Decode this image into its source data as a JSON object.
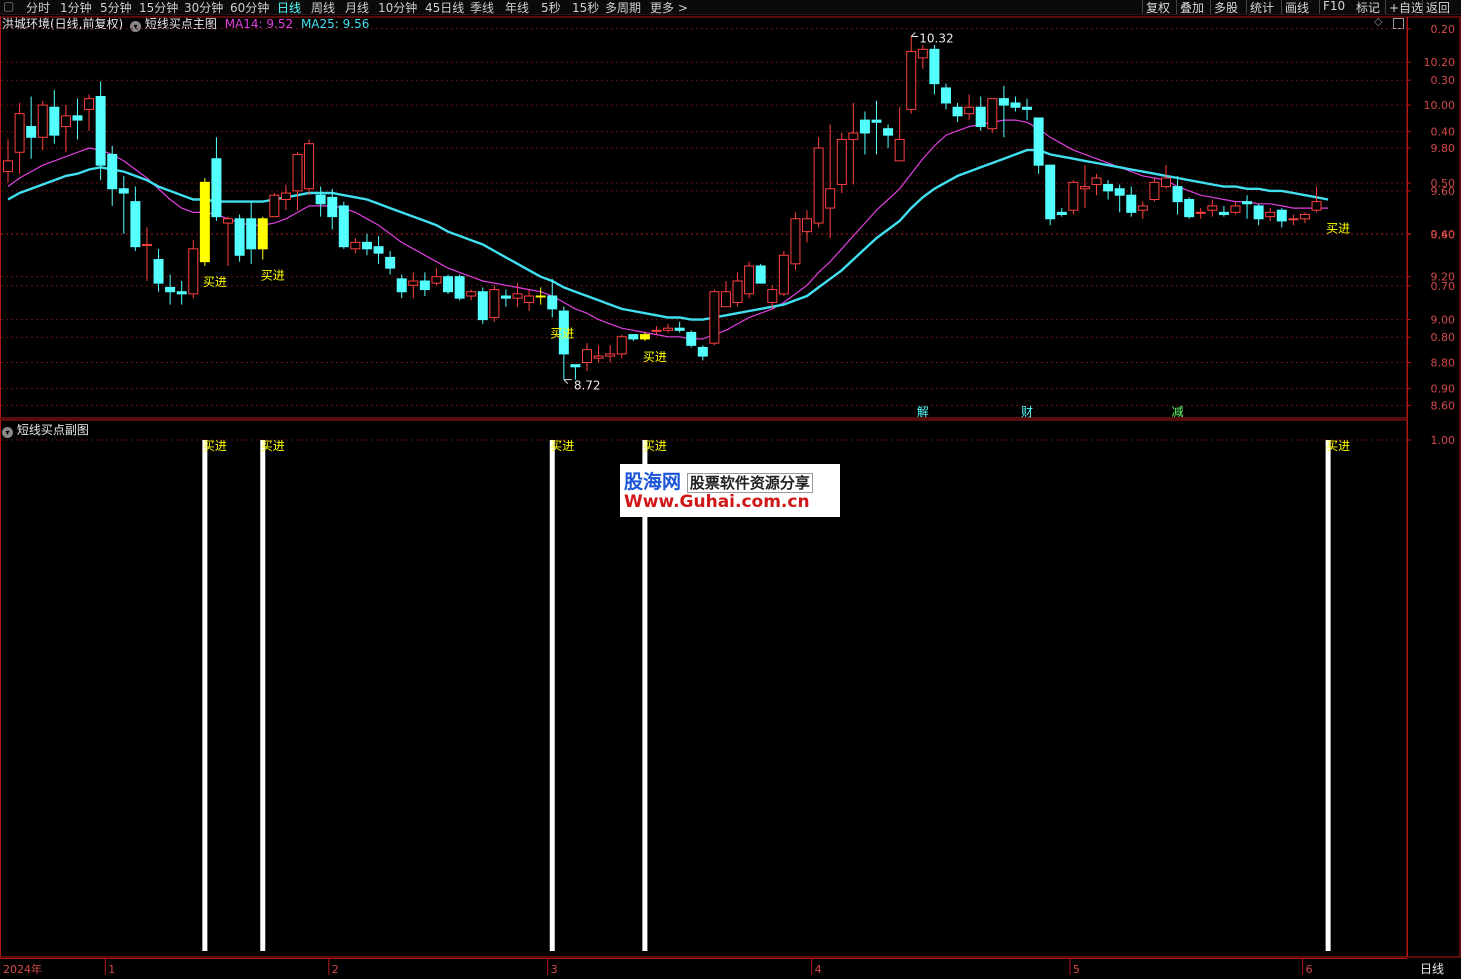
{
  "toolbar": {
    "icon": "square-icon",
    "periods": [
      "分时",
      "1分钟",
      "5分钟",
      "15分钟",
      "30分钟",
      "60分钟",
      "日线",
      "周线",
      "月线",
      "10分钟",
      "45日线",
      "季线",
      "年线",
      "5秒",
      "15秒",
      "多周期",
      "更多 >"
    ],
    "active_period": "日线",
    "right_buttons": [
      "复权",
      "叠加",
      "多股",
      "统计",
      "画线",
      "F10",
      "+自选",
      "返回"
    ],
    "note_button": "标记"
  },
  "main_panel": {
    "stock_title": "洪城环境(日线,前复权)",
    "indicator_name": "短线买点主图",
    "ma14_label": "MA14: 9.52",
    "ma25_label": "MA25: 9.56",
    "high_label": "10.32",
    "low_label": "8.72",
    "signal_text": "买进",
    "event_tags": [
      "解",
      "财",
      "减"
    ]
  },
  "sub_panel": {
    "indicator_name": "短线买点副图",
    "signal_text": "买进"
  },
  "watermark": {
    "line1_a": "股海网",
    "line1_b": "股票软件资源分享",
    "line2": "Www.Guhai.com.cn"
  },
  "x_axis": {
    "labels": [
      "2024年",
      "1",
      "2",
      "3",
      "4",
      "5",
      "6"
    ],
    "period_tag": "日线"
  },
  "colors": {
    "up": "#ff4040",
    "down": "#54ffff",
    "highlight": "#ffff00",
    "ma14": "#e040e0",
    "ma25": "#40e0f0",
    "axis": "#b01818",
    "grid": "#6a1212"
  },
  "chart_data": {
    "type": "candlestick",
    "main_price_axis": [
      8.6,
      8.8,
      9.0,
      9.2,
      9.4,
      9.6,
      9.8,
      10.0,
      10.2
    ],
    "sub_axis": [
      0.2,
      0.3,
      0.4,
      0.5,
      0.6,
      0.7,
      0.8,
      0.9,
      1.0
    ],
    "candles": [
      {
        "o": 9.69,
        "h": 9.84,
        "l": 9.64,
        "c": 9.74
      },
      {
        "o": 9.78,
        "h": 10.01,
        "l": 9.68,
        "c": 9.96
      },
      {
        "o": 9.9,
        "h": 10.04,
        "l": 9.75,
        "c": 9.85
      },
      {
        "o": 9.85,
        "h": 10.02,
        "l": 9.79,
        "c": 10.0
      },
      {
        "o": 9.99,
        "h": 10.07,
        "l": 9.82,
        "c": 9.86
      },
      {
        "o": 9.9,
        "h": 10.0,
        "l": 9.78,
        "c": 9.95
      },
      {
        "o": 9.95,
        "h": 10.03,
        "l": 9.84,
        "c": 9.93
      },
      {
        "o": 9.98,
        "h": 10.05,
        "l": 9.88,
        "c": 10.03
      },
      {
        "o": 10.04,
        "h": 10.11,
        "l": 9.65,
        "c": 9.72
      },
      {
        "o": 9.77,
        "h": 9.81,
        "l": 9.53,
        "c": 9.61
      },
      {
        "o": 9.61,
        "h": 9.67,
        "l": 9.4,
        "c": 9.59
      },
      {
        "o": 9.55,
        "h": 9.62,
        "l": 9.32,
        "c": 9.34
      },
      {
        "o": 9.35,
        "h": 9.43,
        "l": 9.18,
        "c": 9.35
      },
      {
        "o": 9.28,
        "h": 9.33,
        "l": 9.13,
        "c": 9.17
      },
      {
        "o": 9.15,
        "h": 9.21,
        "l": 9.07,
        "c": 9.13
      },
      {
        "o": 9.13,
        "h": 9.18,
        "l": 9.07,
        "c": 9.12
      },
      {
        "o": 9.12,
        "h": 9.37,
        "l": 9.1,
        "c": 9.33
      },
      {
        "o": 9.27,
        "h": 9.66,
        "l": 9.25,
        "c": 9.64
      },
      {
        "o": 9.75,
        "h": 9.85,
        "l": 9.46,
        "c": 9.48
      },
      {
        "o": 9.45,
        "h": 9.48,
        "l": 9.25,
        "c": 9.47
      },
      {
        "o": 9.47,
        "h": 9.49,
        "l": 9.27,
        "c": 9.3
      },
      {
        "o": 9.47,
        "h": 9.55,
        "l": 9.26,
        "c": 9.33
      },
      {
        "o": 9.33,
        "h": 9.48,
        "l": 9.28,
        "c": 9.47
      },
      {
        "o": 9.48,
        "h": 9.59,
        "l": 9.48,
        "c": 9.58
      },
      {
        "o": 9.56,
        "h": 9.63,
        "l": 9.51,
        "c": 9.59
      },
      {
        "o": 9.6,
        "h": 9.78,
        "l": 9.51,
        "c": 9.77
      },
      {
        "o": 9.61,
        "h": 9.84,
        "l": 9.58,
        "c": 9.82
      },
      {
        "o": 9.58,
        "h": 9.62,
        "l": 9.48,
        "c": 9.54
      },
      {
        "o": 9.57,
        "h": 9.61,
        "l": 9.42,
        "c": 9.48
      },
      {
        "o": 9.53,
        "h": 9.55,
        "l": 9.33,
        "c": 9.34
      },
      {
        "o": 9.33,
        "h": 9.38,
        "l": 9.31,
        "c": 9.36
      },
      {
        "o": 9.36,
        "h": 9.4,
        "l": 9.3,
        "c": 9.33
      },
      {
        "o": 9.34,
        "h": 9.39,
        "l": 9.26,
        "c": 9.31
      },
      {
        "o": 9.29,
        "h": 9.32,
        "l": 9.21,
        "c": 9.24
      },
      {
        "o": 9.19,
        "h": 9.21,
        "l": 9.1,
        "c": 9.13
      },
      {
        "o": 9.16,
        "h": 9.22,
        "l": 9.1,
        "c": 9.18
      },
      {
        "o": 9.18,
        "h": 9.22,
        "l": 9.11,
        "c": 9.14
      },
      {
        "o": 9.17,
        "h": 9.24,
        "l": 9.16,
        "c": 9.2
      },
      {
        "o": 9.2,
        "h": 9.21,
        "l": 9.12,
        "c": 9.13
      },
      {
        "o": 9.2,
        "h": 9.21,
        "l": 9.09,
        "c": 9.1
      },
      {
        "o": 9.11,
        "h": 9.14,
        "l": 9.09,
        "c": 9.13
      },
      {
        "o": 9.13,
        "h": 9.15,
        "l": 8.98,
        "c": 9.0
      },
      {
        "o": 9.01,
        "h": 9.16,
        "l": 8.99,
        "c": 9.14
      },
      {
        "o": 9.11,
        "h": 9.14,
        "l": 9.06,
        "c": 9.1
      },
      {
        "o": 9.1,
        "h": 9.17,
        "l": 9.06,
        "c": 9.12
      },
      {
        "o": 9.08,
        "h": 9.14,
        "l": 9.04,
        "c": 9.11
      },
      {
        "o": 9.11,
        "h": 9.15,
        "l": 9.07,
        "c": 9.11
      },
      {
        "o": 9.11,
        "h": 9.19,
        "l": 9.01,
        "c": 9.05
      },
      {
        "o": 9.04,
        "h": 9.06,
        "l": 8.72,
        "c": 8.84
      },
      {
        "o": 8.79,
        "h": 8.79,
        "l": 8.72,
        "c": 8.78
      },
      {
        "o": 8.8,
        "h": 8.89,
        "l": 8.76,
        "c": 8.86
      },
      {
        "o": 8.82,
        "h": 8.88,
        "l": 8.8,
        "c": 8.83
      },
      {
        "o": 8.83,
        "h": 8.88,
        "l": 8.8,
        "c": 8.84
      },
      {
        "o": 8.84,
        "h": 8.93,
        "l": 8.82,
        "c": 8.92
      },
      {
        "o": 8.93,
        "h": 8.93,
        "l": 8.9,
        "c": 8.91
      },
      {
        "o": 8.91,
        "h": 8.94,
        "l": 8.9,
        "c": 8.93
      },
      {
        "o": 8.95,
        "h": 8.97,
        "l": 8.93,
        "c": 8.95
      },
      {
        "o": 8.95,
        "h": 8.98,
        "l": 8.94,
        "c": 8.96
      },
      {
        "o": 8.96,
        "h": 8.99,
        "l": 8.94,
        "c": 8.95
      },
      {
        "o": 8.94,
        "h": 8.95,
        "l": 8.87,
        "c": 8.88
      },
      {
        "o": 8.87,
        "h": 8.88,
        "l": 8.81,
        "c": 8.83
      },
      {
        "o": 8.89,
        "h": 9.14,
        "l": 8.88,
        "c": 9.13
      },
      {
        "o": 9.06,
        "h": 9.18,
        "l": 9.06,
        "c": 9.13
      },
      {
        "o": 9.08,
        "h": 9.22,
        "l": 9.06,
        "c": 9.18
      },
      {
        "o": 9.12,
        "h": 9.27,
        "l": 9.1,
        "c": 9.25
      },
      {
        "o": 9.25,
        "h": 9.26,
        "l": 9.17,
        "c": 9.17
      },
      {
        "o": 9.08,
        "h": 9.16,
        "l": 9.05,
        "c": 9.14
      },
      {
        "o": 9.12,
        "h": 9.32,
        "l": 9.11,
        "c": 9.3
      },
      {
        "o": 9.26,
        "h": 9.5,
        "l": 9.23,
        "c": 9.47
      },
      {
        "o": 9.41,
        "h": 9.51,
        "l": 9.36,
        "c": 9.47
      },
      {
        "o": 9.45,
        "h": 9.85,
        "l": 9.43,
        "c": 9.8
      },
      {
        "o": 9.52,
        "h": 9.91,
        "l": 9.38,
        "c": 9.61
      },
      {
        "o": 9.63,
        "h": 9.87,
        "l": 9.59,
        "c": 9.84
      },
      {
        "o": 9.84,
        "h": 10.01,
        "l": 9.63,
        "c": 9.87
      },
      {
        "o": 9.93,
        "h": 9.97,
        "l": 9.77,
        "c": 9.87
      },
      {
        "o": 9.93,
        "h": 10.02,
        "l": 9.77,
        "c": 9.92
      },
      {
        "o": 9.89,
        "h": 9.91,
        "l": 9.8,
        "c": 9.86
      },
      {
        "o": 9.74,
        "h": 9.99,
        "l": 9.74,
        "c": 9.84
      },
      {
        "o": 9.98,
        "h": 10.32,
        "l": 9.96,
        "c": 10.25
      },
      {
        "o": 10.22,
        "h": 10.28,
        "l": 10.17,
        "c": 10.26
      },
      {
        "o": 10.26,
        "h": 10.28,
        "l": 10.05,
        "c": 10.1
      },
      {
        "o": 10.08,
        "h": 10.1,
        "l": 9.98,
        "c": 10.01
      },
      {
        "o": 9.99,
        "h": 10.01,
        "l": 9.92,
        "c": 9.95
      },
      {
        "o": 9.96,
        "h": 10.05,
        "l": 9.93,
        "c": 9.99
      },
      {
        "o": 9.99,
        "h": 10.04,
        "l": 9.88,
        "c": 9.9
      },
      {
        "o": 9.89,
        "h": 10.03,
        "l": 9.87,
        "c": 10.03
      },
      {
        "o": 10.03,
        "h": 10.09,
        "l": 9.85,
        "c": 10.0
      },
      {
        "o": 10.01,
        "h": 10.04,
        "l": 9.97,
        "c": 9.99
      },
      {
        "o": 9.99,
        "h": 10.03,
        "l": 9.93,
        "c": 9.98
      },
      {
        "o": 9.94,
        "h": 9.94,
        "l": 9.68,
        "c": 9.72
      },
      {
        "o": 9.72,
        "h": 9.72,
        "l": 9.44,
        "c": 9.47
      },
      {
        "o": 9.5,
        "h": 9.52,
        "l": 9.48,
        "c": 9.49
      },
      {
        "o": 9.51,
        "h": 9.65,
        "l": 9.49,
        "c": 9.64
      },
      {
        "o": 9.61,
        "h": 9.72,
        "l": 9.52,
        "c": 9.62
      },
      {
        "o": 9.63,
        "h": 9.68,
        "l": 9.58,
        "c": 9.66
      },
      {
        "o": 9.63,
        "h": 9.65,
        "l": 9.56,
        "c": 9.6
      },
      {
        "o": 9.61,
        "h": 9.63,
        "l": 9.5,
        "c": 9.58
      },
      {
        "o": 9.58,
        "h": 9.62,
        "l": 9.48,
        "c": 9.5
      },
      {
        "o": 9.51,
        "h": 9.55,
        "l": 9.47,
        "c": 9.53
      },
      {
        "o": 9.56,
        "h": 9.66,
        "l": 9.55,
        "c": 9.64
      },
      {
        "o": 9.62,
        "h": 9.72,
        "l": 9.61,
        "c": 9.66
      },
      {
        "o": 9.62,
        "h": 9.67,
        "l": 9.49,
        "c": 9.55
      },
      {
        "o": 9.56,
        "h": 9.57,
        "l": 9.47,
        "c": 9.48
      },
      {
        "o": 9.5,
        "h": 9.52,
        "l": 9.47,
        "c": 9.5
      },
      {
        "o": 9.51,
        "h": 9.56,
        "l": 9.48,
        "c": 9.53
      },
      {
        "o": 9.5,
        "h": 9.53,
        "l": 9.48,
        "c": 9.49
      },
      {
        "o": 9.5,
        "h": 9.55,
        "l": 9.49,
        "c": 9.53
      },
      {
        "o": 9.55,
        "h": 9.58,
        "l": 9.47,
        "c": 9.54
      },
      {
        "o": 9.53,
        "h": 9.54,
        "l": 9.44,
        "c": 9.47
      },
      {
        "o": 9.48,
        "h": 9.52,
        "l": 9.46,
        "c": 9.5
      },
      {
        "o": 9.51,
        "h": 9.52,
        "l": 9.43,
        "c": 9.46
      },
      {
        "o": 9.47,
        "h": 9.49,
        "l": 9.44,
        "c": 9.47
      },
      {
        "o": 9.47,
        "h": 9.5,
        "l": 9.45,
        "c": 9.49
      },
      {
        "o": 9.51,
        "h": 9.62,
        "l": 9.5,
        "c": 9.55
      }
    ],
    "buy_signal_indices": [
      17,
      22,
      47,
      55,
      114
    ],
    "buy_candle_indices": [
      17,
      22,
      46,
      55,
      114
    ],
    "event_tag_indices": [
      79,
      88,
      101
    ],
    "ma14": [
      9.62,
      9.66,
      9.69,
      9.72,
      9.74,
      9.76,
      9.78,
      9.8,
      9.79,
      9.77,
      9.74,
      9.7,
      9.66,
      9.61,
      9.56,
      9.52,
      9.5,
      9.5,
      9.49,
      9.47,
      9.45,
      9.44,
      9.44,
      9.45,
      9.47,
      9.5,
      9.53,
      9.53,
      9.53,
      9.52,
      9.5,
      9.47,
      9.44,
      9.4,
      9.36,
      9.33,
      9.3,
      9.27,
      9.24,
      9.22,
      9.2,
      9.18,
      9.17,
      9.16,
      9.15,
      9.14,
      9.13,
      9.11,
      9.08,
      9.05,
      9.03,
      9.0,
      8.98,
      8.96,
      8.95,
      8.94,
      8.93,
      8.92,
      8.92,
      8.91,
      8.91,
      8.93,
      8.95,
      8.98,
      9.01,
      9.03,
      9.05,
      9.08,
      9.12,
      9.16,
      9.22,
      9.27,
      9.33,
      9.39,
      9.45,
      9.51,
      9.56,
      9.61,
      9.68,
      9.75,
      9.81,
      9.86,
      9.88,
      9.9,
      9.91,
      9.92,
      9.93,
      9.93,
      9.92,
      9.89,
      9.85,
      9.82,
      9.79,
      9.77,
      9.75,
      9.73,
      9.71,
      9.69,
      9.67,
      9.66,
      9.65,
      9.62,
      9.6,
      9.58,
      9.57,
      9.56,
      9.55,
      9.55,
      9.54,
      9.54,
      9.53,
      9.52,
      9.52,
      9.52,
      9.52
    ],
    "ma25": [
      9.56,
      9.59,
      9.61,
      9.63,
      9.65,
      9.67,
      9.68,
      9.7,
      9.71,
      9.7,
      9.69,
      9.67,
      9.65,
      9.62,
      9.6,
      9.58,
      9.56,
      9.56,
      9.55,
      9.55,
      9.55,
      9.55,
      9.55,
      9.56,
      9.57,
      9.58,
      9.59,
      9.59,
      9.59,
      9.58,
      9.57,
      9.56,
      9.54,
      9.52,
      9.5,
      9.48,
      9.46,
      9.44,
      9.41,
      9.39,
      9.37,
      9.35,
      9.32,
      9.29,
      9.26,
      9.23,
      9.2,
      9.18,
      9.15,
      9.13,
      9.11,
      9.09,
      9.07,
      9.05,
      9.04,
      9.03,
      9.02,
      9.01,
      9.01,
      9.0,
      9.0,
      9.01,
      9.02,
      9.03,
      9.04,
      9.05,
      9.06,
      9.07,
      9.09,
      9.11,
      9.15,
      9.19,
      9.23,
      9.28,
      9.33,
      9.38,
      9.42,
      9.46,
      9.52,
      9.57,
      9.61,
      9.64,
      9.67,
      9.69,
      9.71,
      9.73,
      9.75,
      9.77,
      9.79,
      9.79,
      9.77,
      9.76,
      9.75,
      9.74,
      9.73,
      9.72,
      9.71,
      9.7,
      9.69,
      9.68,
      9.67,
      9.66,
      9.65,
      9.64,
      9.63,
      9.62,
      9.62,
      9.61,
      9.61,
      9.6,
      9.6,
      9.59,
      9.58,
      9.57,
      9.56
    ]
  }
}
